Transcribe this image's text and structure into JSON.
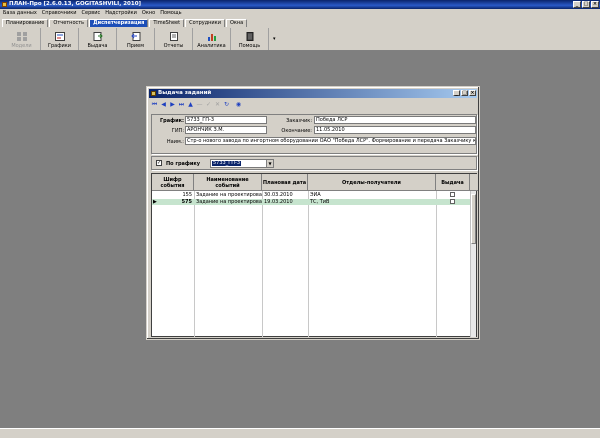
{
  "window": {
    "title": "ПЛАН-Про [2.6.0.13, GOGITASHVILI, 2010]"
  },
  "menu": [
    "База данных",
    "Справочники",
    "Сервис",
    "Надстройки",
    "Окно",
    "Помощь"
  ],
  "tabs": [
    "Планирование",
    "Отчетность",
    "Диспетчеризация",
    "TimeSheet",
    "Сотрудники",
    "Окна"
  ],
  "active_tab": "Диспетчеризация",
  "ribbon": [
    {
      "label": "Модели",
      "icon": "models-icon",
      "enabled": false
    },
    {
      "label": "Графики",
      "icon": "charts-icon",
      "enabled": true
    },
    {
      "label": "Выдача",
      "icon": "issue-icon",
      "enabled": true
    },
    {
      "label": "Прием",
      "icon": "receive-icon",
      "enabled": true
    },
    {
      "label": "Отчеты",
      "icon": "reports-icon",
      "enabled": true
    },
    {
      "label": "Аналитика",
      "icon": "analytics-icon",
      "enabled": true
    },
    {
      "label": "Помощь",
      "icon": "help-book-icon",
      "enabled": true
    }
  ],
  "dialog": {
    "title": "Выдача заданий",
    "fields": {
      "grafik_label": "График:",
      "grafik_value": "5733_ГП-3",
      "gip_label": "ГИП:",
      "gip_value": "АРОНЧИК З.М.",
      "name_label": "Наим.:",
      "name_value": "Стр-о нового завода по ингортном оборудовании ОАО \"Победа ЛСР\". Формирование и передача Заказчику контактной",
      "customer_label": "Заказчик:",
      "customer_value": "Победа ЛСР",
      "end_label": "Окончание:",
      "end_value": "11.05.2010"
    },
    "filter": {
      "label": "По графику",
      "checked": true,
      "value": "5733_ГП-3"
    },
    "grid": {
      "columns": [
        "Шифр события",
        "Наименование событий",
        "Плановая дата",
        "Отделы-получатели",
        "Выдача"
      ],
      "rows": [
        {
          "code": "155",
          "name": "Задание на проектирован...",
          "date": "30.03.2010",
          "depts": "ЭИА",
          "issued": false,
          "selected": false
        },
        {
          "code": "575",
          "name": "Задание на проектирован...",
          "date": "19.03.2010",
          "depts": "ТС, ТиВ",
          "issued": false,
          "selected": true
        }
      ]
    }
  }
}
